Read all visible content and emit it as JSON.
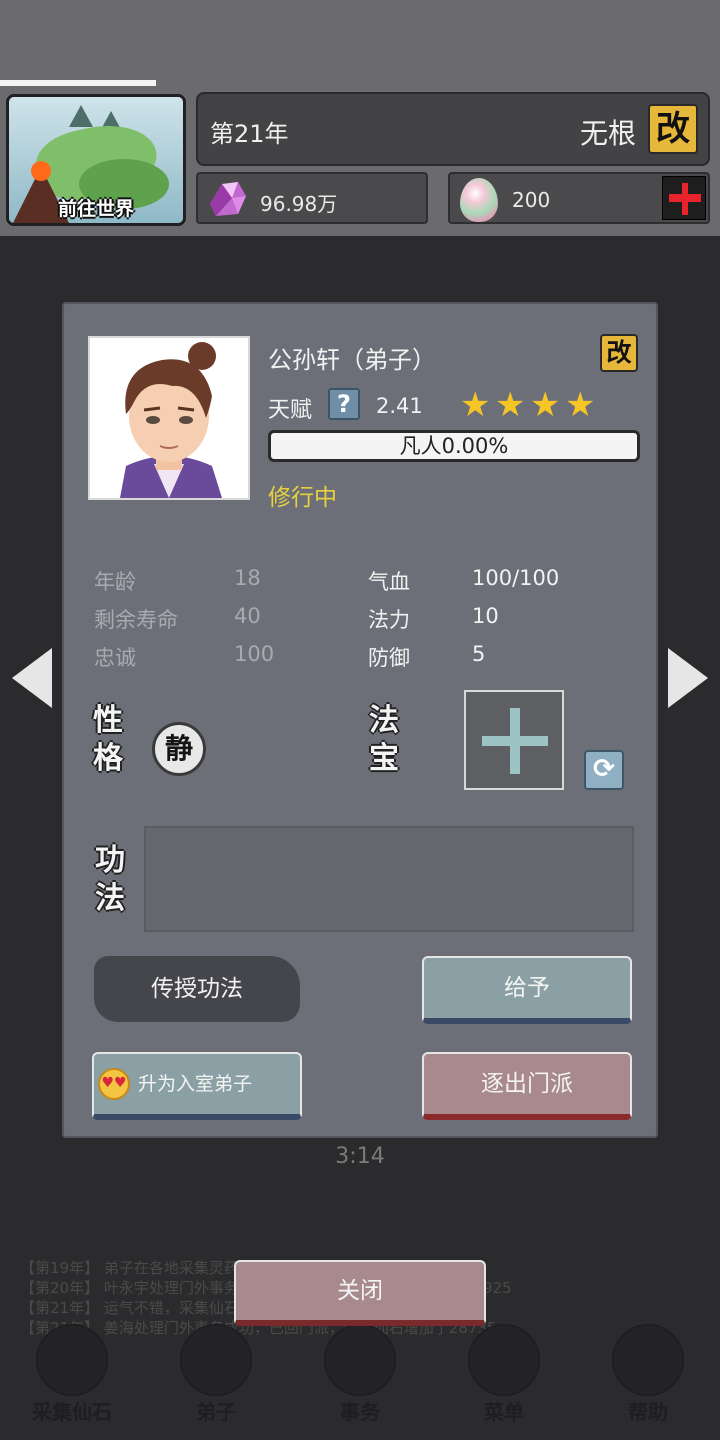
{
  "header": {
    "world_button_label": "前往世界",
    "year": "第21年",
    "root": "无根",
    "change_icon_char": "改",
    "spirit_stones": "96.98万",
    "gems": "200"
  },
  "disciple": {
    "name": "公孙轩（弟子）",
    "talent_label": "天赋",
    "help_char": "?",
    "talent_value": "2.41",
    "stars": [
      "★",
      "★",
      "★",
      "★"
    ],
    "realm": "凡人0.00%",
    "realm_progress": 0.0,
    "status": "修行中",
    "stats_left": [
      {
        "label": "年龄",
        "value": "18"
      },
      {
        "label": "剩余寿命",
        "value": "40"
      },
      {
        "label": "忠诚",
        "value": "100"
      }
    ],
    "stats_right": [
      {
        "label": "气血",
        "value": "100/100"
      },
      {
        "label": "法力",
        "value": "10"
      },
      {
        "label": "防御",
        "value": "5"
      }
    ],
    "personality_title": [
      "性",
      "格"
    ],
    "personality": "静",
    "treasure_title": [
      "法",
      "宝"
    ],
    "technique_title": [
      "功",
      "法"
    ],
    "swap_char": "⟳"
  },
  "actions": {
    "teach": "传授功法",
    "give": "给予",
    "promote": "升为入室弟子",
    "expel": "逐出门派",
    "close": "关闭"
  },
  "background": {
    "log": [
      "【第19年】 弟子在各地采集灵药获得巨大收获，人赚了300000仙石",
      "【第20年】 叶永宇处理门外事务成功，已回门派，门派仙石增加了27925",
      "【第21年】 运气不错，采集仙石时意外获得1个宝灵石",
      "【第21年】 姜海处理门外事务成功，已回门派，门派仙石增加了28735"
    ],
    "time": "3:14",
    "nav": [
      "采集仙石",
      "弟子",
      "事务",
      "菜单",
      "帮助"
    ]
  },
  "colors": {
    "accent_gold": "#e6b73a",
    "status_yellow": "#e6d23c",
    "star": "#f5c526",
    "modal_bg": "#6d6f78"
  }
}
